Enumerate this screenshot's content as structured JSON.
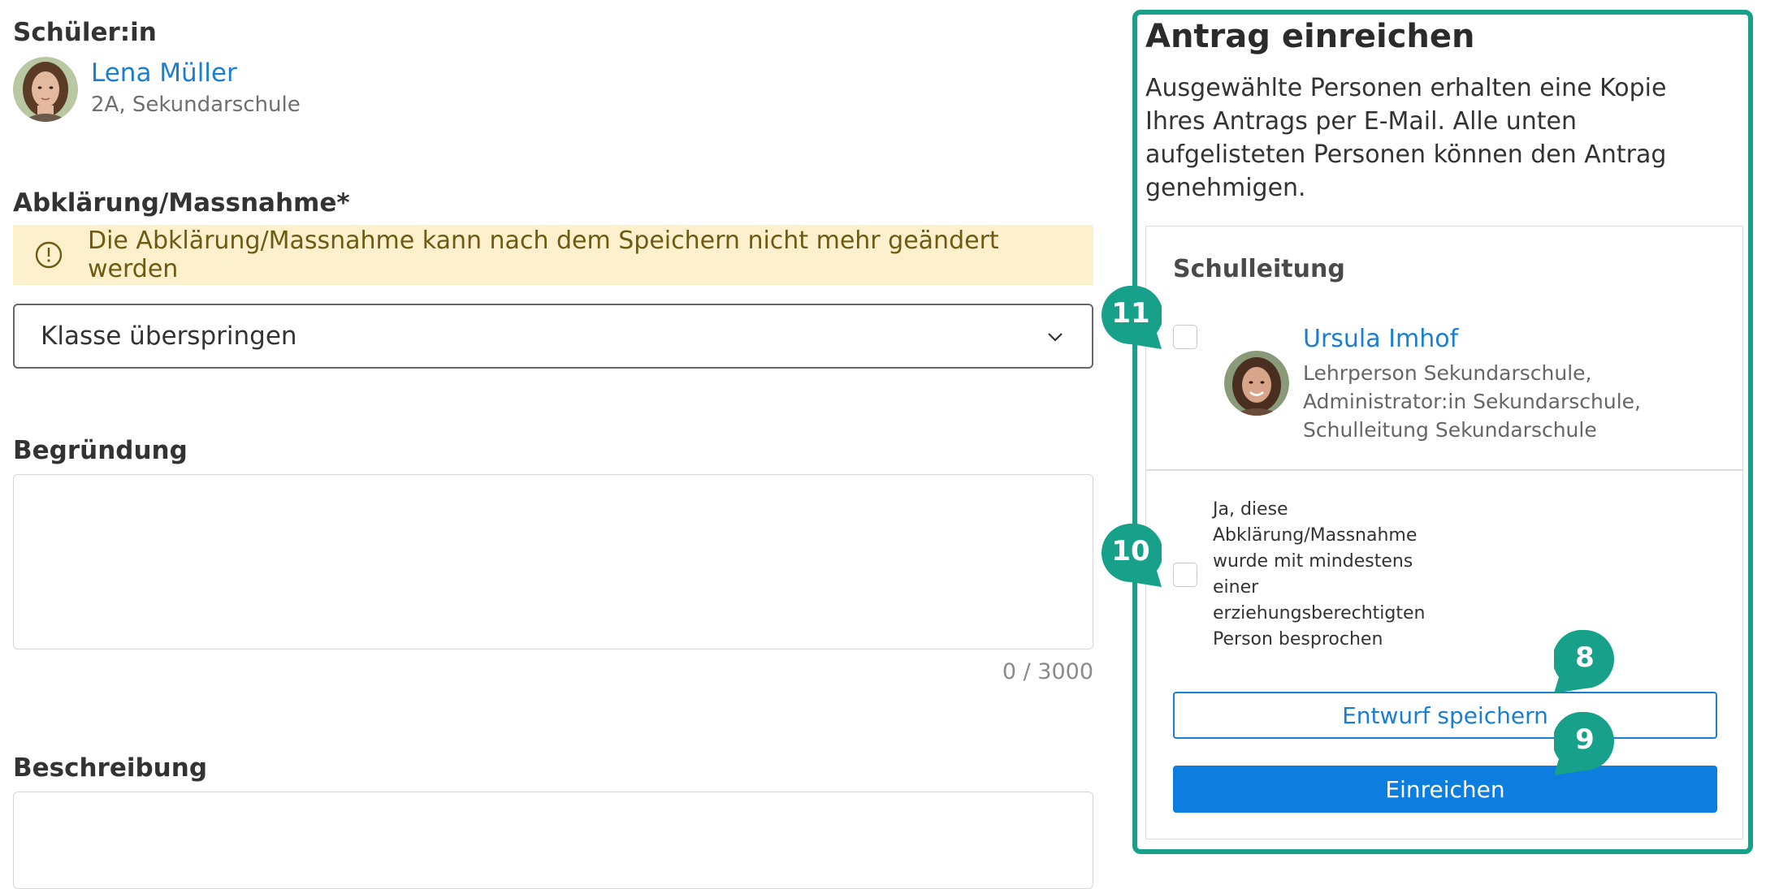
{
  "student": {
    "section_label": "Schüler:in",
    "name": "Lena Müller",
    "class_info": "2A, Sekundarschule"
  },
  "measure": {
    "label": "Abklärung/Massnahme*",
    "notice": "Die Abklärung/Massnahme kann nach dem Speichern nicht mehr geändert werden",
    "selected_value": "Klasse überspringen"
  },
  "reason": {
    "label": "Begründung",
    "value": "",
    "counter": "0 / 3000"
  },
  "description": {
    "label": "Beschreibung",
    "value": ""
  },
  "panel": {
    "title": "Antrag einreichen",
    "description": "Ausgewählte Personen erhalten eine Kopie Ihres Antrags per E-Mail. Alle unten aufgelisteten Personen können den Antrag genehmigen.",
    "section_title": "Schulleitung",
    "approver": {
      "name": "Ursula Imhof",
      "roles": [
        "Lehrperson Sekundarschule,",
        "Administrator:in Sekundarschule,",
        "Schulleitung Sekundarschule"
      ]
    },
    "confirm_text": "Ja, diese Abklärung/Massnahme wurde mit mindestens einer erziehungsberechtigten Person besprochen",
    "save_draft_label": "Entwurf speichern",
    "submit_label": "Einreichen"
  },
  "markers": [
    "11",
    "10",
    "8",
    "9"
  ],
  "colors": {
    "accent_teal": "#17a08a",
    "link_blue": "#1a7fd1",
    "primary_button": "#0d7ee0",
    "notice_bg": "#fdf0cc",
    "notice_text": "#6e5a12"
  },
  "icons": [
    "student-avatar",
    "warning-circle-icon",
    "chevron-down-icon",
    "approver-avatar",
    "callout-marker"
  ]
}
